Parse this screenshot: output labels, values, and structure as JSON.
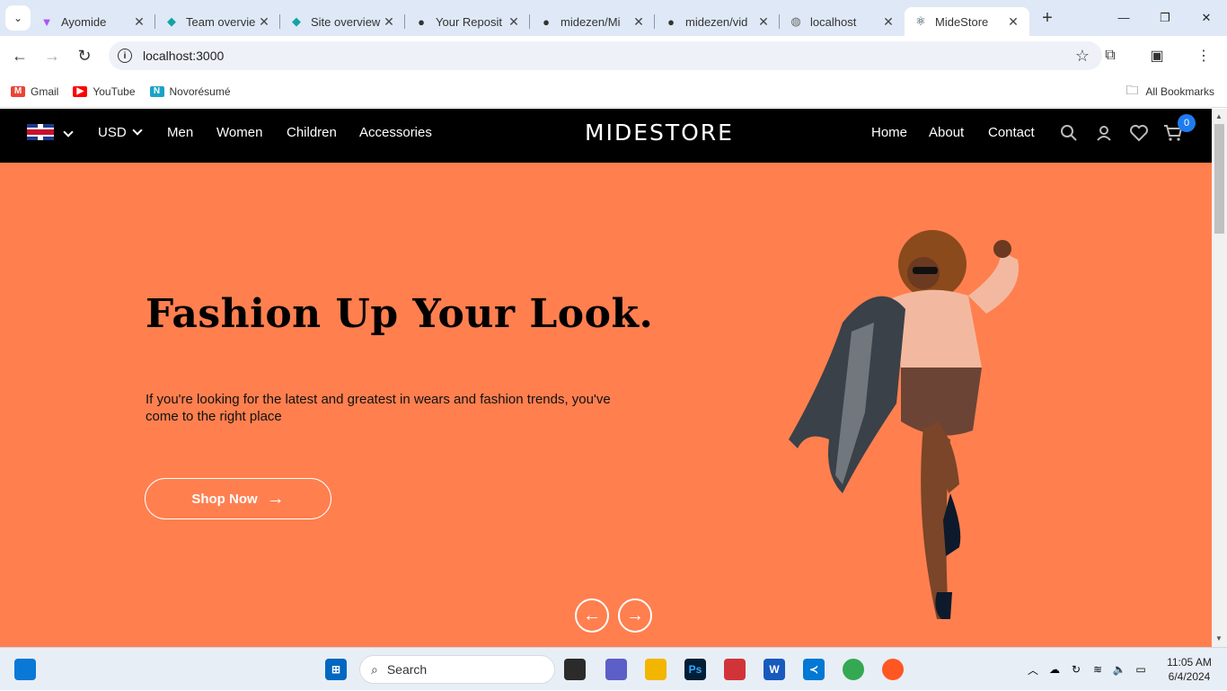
{
  "browser": {
    "tabs": [
      {
        "title": "Ayomide",
        "icon": "triangle-icon",
        "color": "#a855f7"
      },
      {
        "title": "Team overvie",
        "icon": "netlify-icon",
        "color": "#14a3a3"
      },
      {
        "title": "Site overview",
        "icon": "netlify-icon",
        "color": "#14a3a3"
      },
      {
        "title": "Your Reposit",
        "icon": "github-icon",
        "color": "#111111"
      },
      {
        "title": "midezen/Mi",
        "icon": "github-icon",
        "color": "#111111"
      },
      {
        "title": "midezen/vid",
        "icon": "github-icon",
        "color": "#111111"
      },
      {
        "title": "localhost",
        "icon": "globe-icon",
        "color": "#666666"
      },
      {
        "title": "MideStore",
        "icon": "react-icon",
        "color": "#0b2d3a"
      }
    ],
    "url": "localhost:3000",
    "bookmarks": [
      {
        "label": "Gmail",
        "icon": "gmail-icon",
        "color": "#ea4335",
        "glyph": "M"
      },
      {
        "label": "YouTube",
        "icon": "youtube-icon",
        "color": "#ff0000",
        "glyph": "▶"
      },
      {
        "label": "Novorésumé",
        "icon": "novoresume-icon",
        "color": "#1aa3c7",
        "glyph": "N"
      }
    ],
    "all_bookmarks": "All Bookmarks"
  },
  "site": {
    "currency": "USD",
    "categories": [
      "Men",
      "Women",
      "Children",
      "Accessories"
    ],
    "brand": "MIDESTORE",
    "links": [
      "Home",
      "About",
      "Contact"
    ],
    "cart_count": "0",
    "accent": "#ff7f4f",
    "hero": {
      "title": "Fashion Up Your Look.",
      "text": "If you're looking for the latest and greatest in wears and fashion trends, you've come to the right place",
      "cta": "Shop Now"
    }
  },
  "taskbar": {
    "search_placeholder": "Search",
    "time": "11:05 AM",
    "date": "6/4/2024"
  }
}
